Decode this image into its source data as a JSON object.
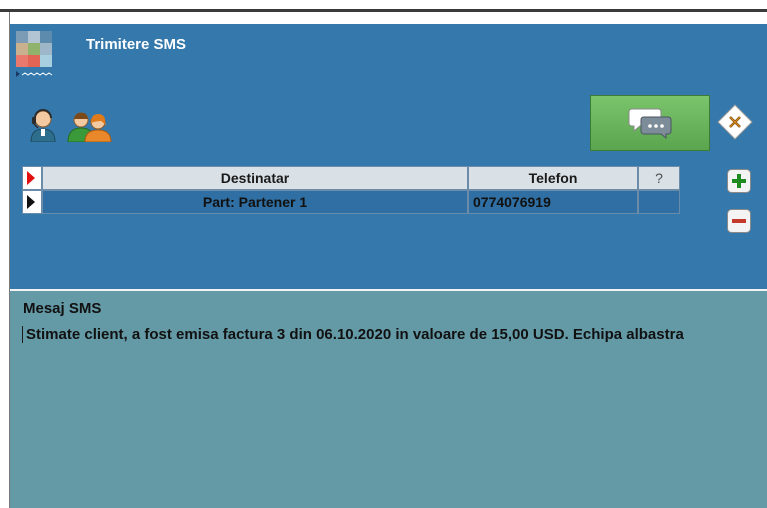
{
  "window": {
    "title": "Trimitere SMS"
  },
  "toolbar": {
    "contact_icon": "person-headset-icon",
    "group_icon": "group-contacts-icon",
    "send_icon": "chat-bubbles-icon",
    "close_icon": "close-x-icon"
  },
  "grid": {
    "columns": [
      "Destinatar",
      "Telefon",
      "?"
    ],
    "rows": [
      {
        "destinatar": "Part: Partener 1",
        "telefon": "0774076919",
        "flag": ""
      }
    ]
  },
  "side_buttons": {
    "add_icon": "plus-icon",
    "remove_icon": "minus-icon"
  },
  "message": {
    "label": "Mesaj SMS",
    "text": "Stimate client, a fost emisa factura 3 din 06.10.2020 in valoare de 15,00 USD. Echipa albastra"
  },
  "colors": {
    "main_bg": "#3478ac",
    "message_bg": "#6499a6",
    "send_button": "#6ab45e",
    "row_indicator_red": "#e01010"
  }
}
